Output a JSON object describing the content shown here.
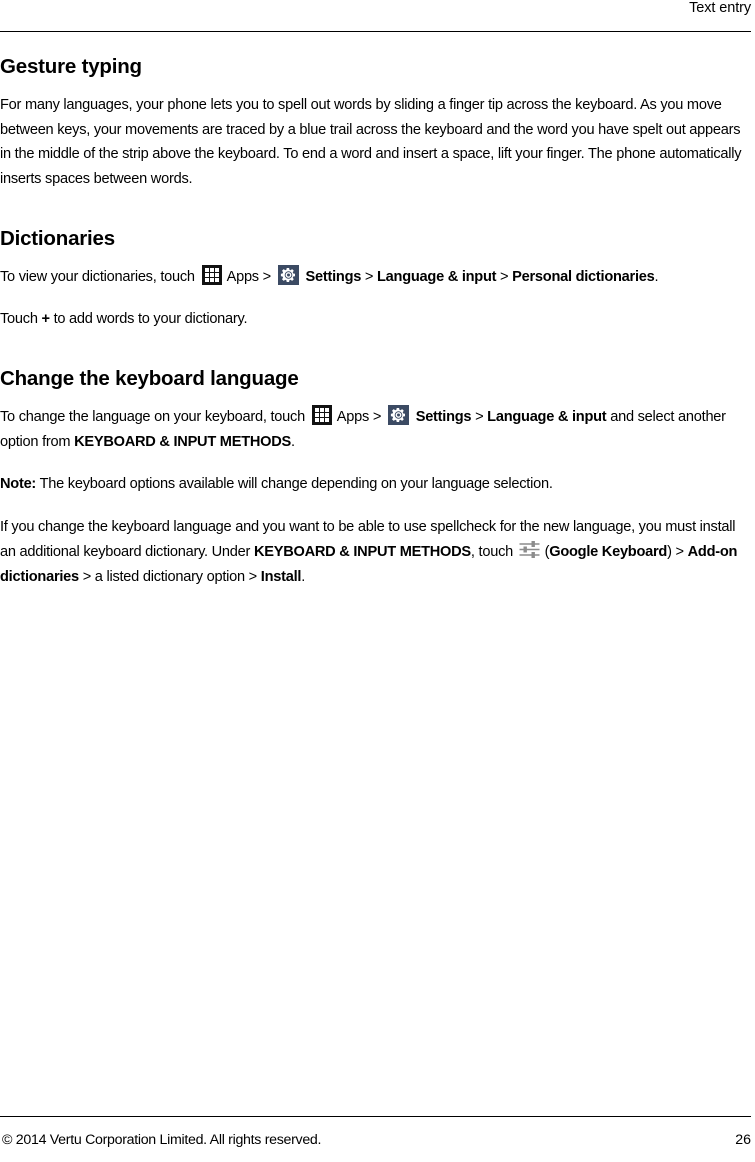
{
  "header": {
    "title": "Text entry"
  },
  "sections": {
    "gesture_typing": {
      "heading": "Gesture typing",
      "paragraph": "For many languages, your phone lets you to spell out words by sliding a finger tip across the keyboard. As you move between keys, your movements are traced by a blue trail across the keyboard and the word you have spelt out appears in the middle of the strip above the keyboard. To end a word and insert a space, lift your finger. The phone automatically inserts spaces between words."
    },
    "dictionaries": {
      "heading": "Dictionaries",
      "line1": {
        "prefix": "To view your dictionaries, touch ",
        "apps_label": " Apps",
        "sep1": " > ",
        "settings_label": " Settings",
        "sep2": " > ",
        "language_input": "Language & input",
        "sep3": " > ",
        "personal_dictionaries": "Personal dictionaries",
        "suffix": "."
      },
      "line2": {
        "prefix": "Touch ",
        "plus": "+",
        "suffix": " to add words to your dictionary."
      }
    },
    "change_keyboard_language": {
      "heading": "Change the keyboard language",
      "para1": {
        "prefix": "To change the language on your keyboard, touch ",
        "apps_label": " Apps",
        "sep1": " > ",
        "settings_label": " Settings",
        "sep2": " > ",
        "language_input": "Language & input",
        "mid": " and select another option from ",
        "keyboard_input_methods": "KEYBOARD & INPUT METHODS",
        "suffix": "."
      },
      "note": {
        "label": "Note:",
        "text": " The keyboard options available will change depending on your language selection."
      },
      "para2": {
        "part1": "If you change the keyboard language and you want to be able to use spellcheck for the new language, you must install an additional keyboard dictionary. Under ",
        "keyboard_input_methods": "KEYBOARD & INPUT METHODS",
        "part2": ", touch ",
        "part3": " (",
        "google_keyboard": "Google Keyboard",
        "part4": ") > ",
        "addon_dictionaries": "Add-on dictionaries",
        "part5": " > a listed dictionary option > ",
        "install": "Install",
        "suffix": "."
      }
    }
  },
  "footer": {
    "copyright": "© 2014 Vertu Corporation Limited. All rights reserved.",
    "page_number": "26"
  },
  "icons": {
    "apps": "apps-grid-icon",
    "settings": "gear-icon",
    "sliders": "sliders-icon"
  },
  "colors": {
    "apps_icon_bg": "#121212",
    "settings_icon_bg": "#3b4a63",
    "sliders_icon": "#8c8c8c",
    "text": "#000000",
    "page_bg": "#ffffff"
  }
}
